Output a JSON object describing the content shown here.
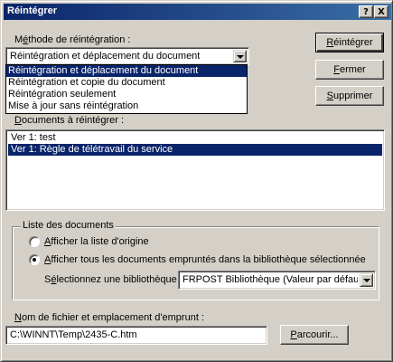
{
  "window": {
    "title": "Réintégrer",
    "help_label": "?",
    "close_label": "X"
  },
  "method": {
    "label_prefix": "M",
    "label_accel": "é",
    "label_suffix": "thode de réintégration :",
    "selected": "Réintégration et déplacement du document",
    "options": [
      "Réintégration et déplacement du document",
      "Réintégration et copie du document",
      "Réintégration seulement",
      "Mise à jour sans réintégration"
    ]
  },
  "buttons": {
    "reintegrer_accel": "R",
    "reintegrer_rest": "éintégrer",
    "fermer_accel": "F",
    "fermer_rest": "ermer",
    "supprimer_accel": "S",
    "supprimer_rest": "upprimer",
    "parcourir_accel": "P",
    "parcourir_rest": "arcourir..."
  },
  "documents": {
    "label_accel": "D",
    "label_rest": "ocuments à réintégrer :",
    "items": [
      "Ver  1: test",
      "Ver  1: Règle de télétravail du service"
    ]
  },
  "list_group": {
    "legend": "Liste des documents",
    "option1_accel": "A",
    "option1_rest": "fficher la liste d'origine",
    "option2_accel": "A",
    "option2_rest": "fficher tous les documents empruntés dans la bibliothèque sélectionnée",
    "library_label_prefix": "S",
    "library_label_accel": "é",
    "library_label_suffix": "lectionnez une bibliothèque :",
    "library_value": "FRPOST Bibliothèque  (Valeur par défaut)"
  },
  "file": {
    "label_accel": "N",
    "label_rest": "om de fichier et emplacement d'emprunt :",
    "value": "C:\\WINNT\\Temp\\2435-C.htm"
  }
}
